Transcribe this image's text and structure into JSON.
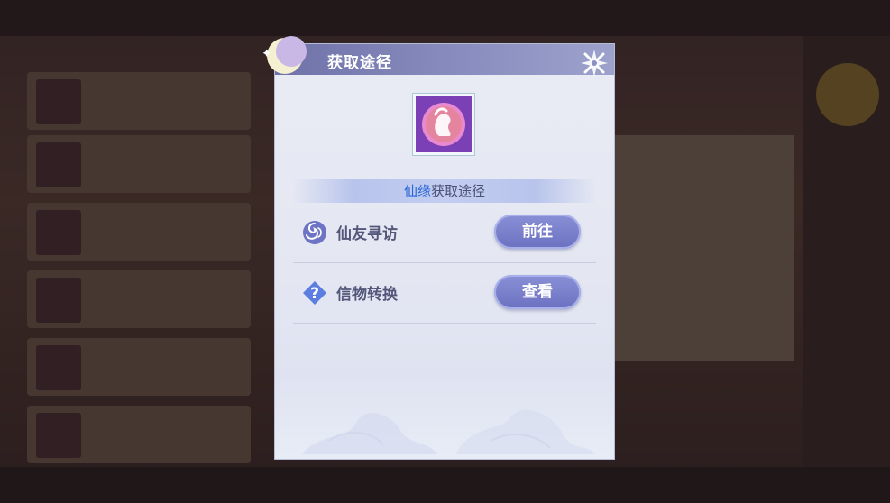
{
  "modal": {
    "title": "获取途径",
    "close_icon": "close-x-icon",
    "item_icon": "xianyuan-portrait-icon",
    "section": {
      "highlight": "仙缘",
      "rest": "获取途径"
    },
    "rows": [
      {
        "icon": "yin-yang-swirl-icon",
        "label": "仙友寻访",
        "button": "前往"
      },
      {
        "icon": "question-diamond-icon",
        "label": "信物转换",
        "button": "查看"
      }
    ]
  },
  "colors": {
    "header": "#7a7eb4",
    "button": "#7a80cc",
    "highlight": "#2a66d6",
    "panel": "#e6e9f3"
  }
}
